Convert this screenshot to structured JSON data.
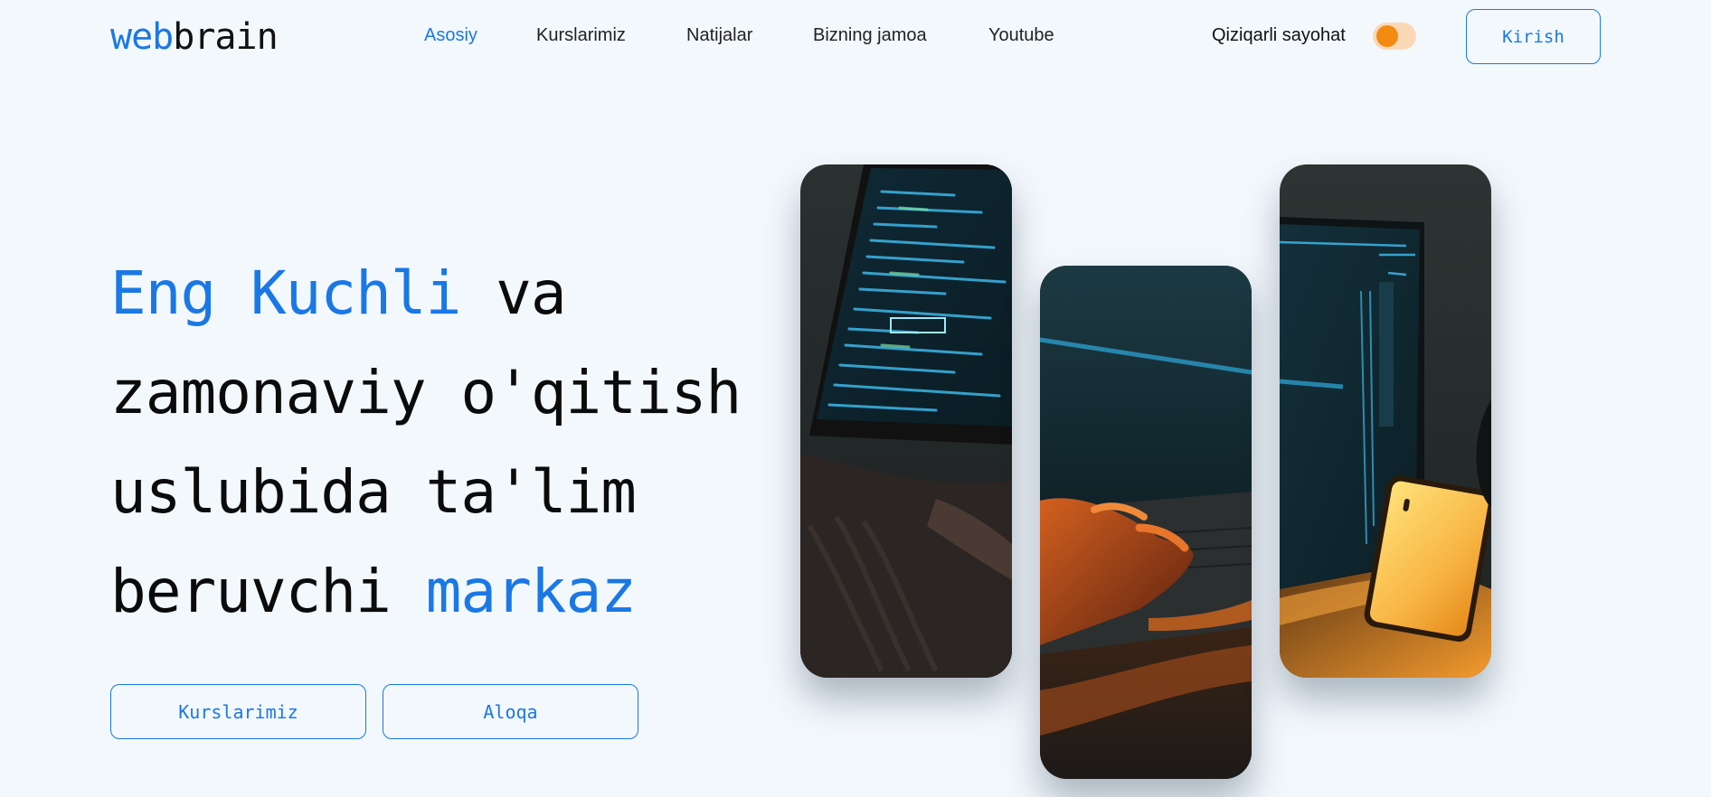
{
  "header": {
    "logo_accent": "web",
    "logo_rest": "brain",
    "nav": [
      {
        "label": "Asosiy",
        "active": true
      },
      {
        "label": "Kurslarimiz",
        "active": false
      },
      {
        "label": "Natijalar",
        "active": false
      },
      {
        "label": "Bizning jamoa",
        "active": false
      },
      {
        "label": "Youtube",
        "active": false
      }
    ],
    "theme_toggle_label": "Qiziqarli sayohat",
    "theme_toggle_on": false,
    "login_label": "Kirish"
  },
  "hero": {
    "title_accent_1": "Eng Kuchli",
    "title_part_1": " va",
    "title_line_2": "zamonaviy o'qitish",
    "title_line_3": "uslubida ta'lim",
    "title_part_4": "beruvchi ",
    "title_accent_2": "markaz",
    "primary_button": "Kurslarimiz",
    "secondary_button": "Aloqa"
  },
  "gallery": {
    "images": [
      {
        "name": "code-laptop-photo"
      },
      {
        "name": "typing-hands-photo"
      },
      {
        "name": "laptop-phone-photo"
      }
    ]
  },
  "colors": {
    "accent": "#1a78e6",
    "background": "#f3f8fd",
    "toggle_knob": "#f38a12"
  }
}
